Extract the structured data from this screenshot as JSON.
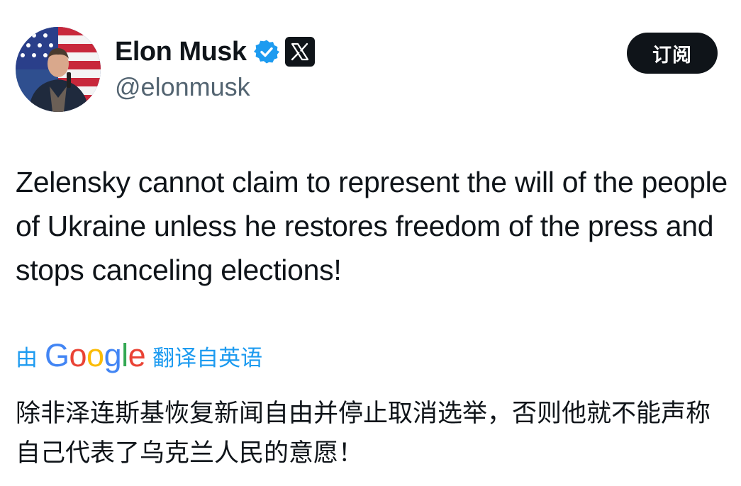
{
  "author": {
    "display_name": "Elon Musk",
    "handle": "@elonmusk",
    "avatar_icon": "user-avatar-photo",
    "verified_icon": "verified-badge-icon",
    "affiliation_icon": "x-logo-icon"
  },
  "subscribe_label": "订阅",
  "tweet": {
    "text": "Zelensky cannot claim to represent the will of the people of Ukraine unless he restores freedom of the press and stops canceling elections!"
  },
  "translation": {
    "prefix": "由",
    "provider": "Google",
    "suffix": "翻译自英语",
    "text": "除非泽连斯基恢复新闻自由并停止取消选举，否则他就不能声称自己代表了乌克兰人民的意愿！"
  },
  "colors": {
    "text": "#0f1419",
    "secondary_text": "#536471",
    "link_blue": "#1d9bf0",
    "button_bg": "#0f1419",
    "verified_blue": "#1d9bf0"
  }
}
